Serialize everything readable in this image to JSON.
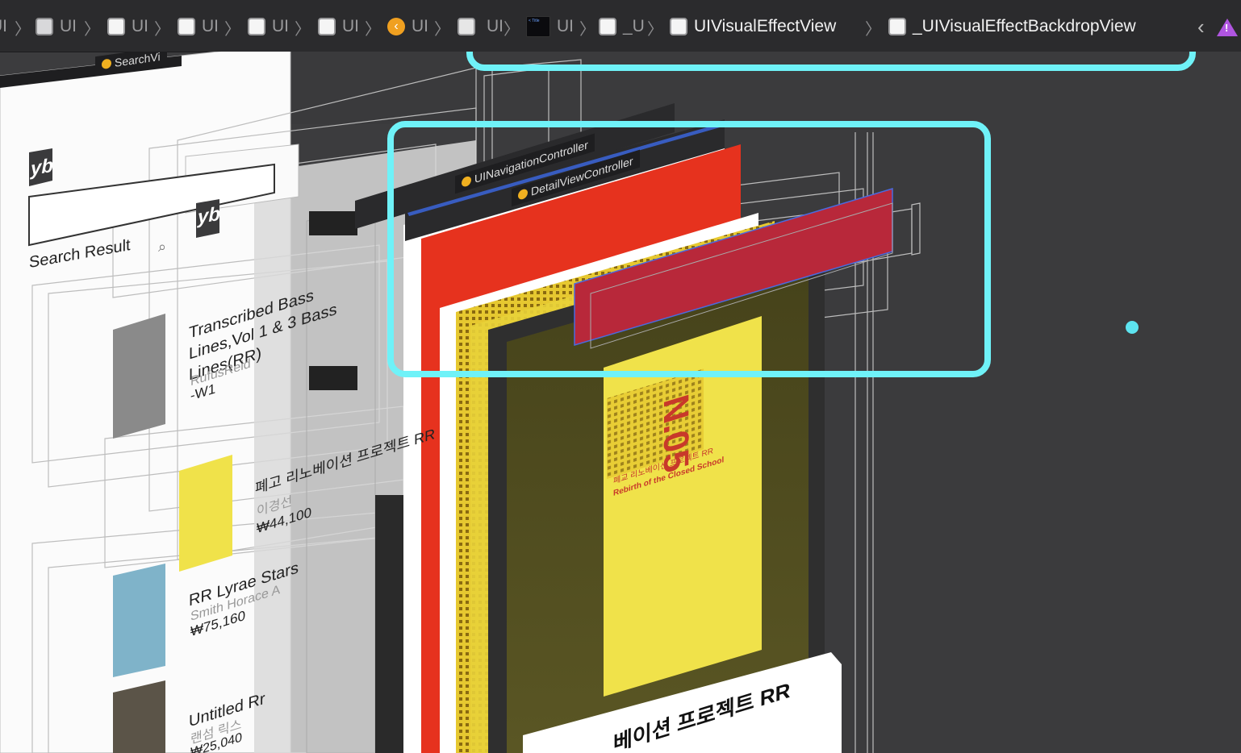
{
  "breadcrumb": {
    "items": [
      {
        "label": "UI"
      },
      {
        "label": "UI"
      },
      {
        "label": "UI"
      },
      {
        "label": "UI"
      },
      {
        "label": "UI"
      },
      {
        "label": "UI"
      },
      {
        "label": "UI"
      },
      {
        "label": "UI"
      },
      {
        "label": "_U"
      },
      {
        "label": "UIVisualEffectView"
      },
      {
        "label": "_UIVisualEffectBackdropView"
      }
    ],
    "nav_title_icon_text": "< Title"
  },
  "hierarchy": {
    "search_tag": "SearchVi",
    "nav_controller_tag": "UINavigationController",
    "detail_controller_tag": "DetailViewController",
    "search_result_label": "Search Result",
    "logo_text": "yb"
  },
  "results": [
    {
      "title": "Transcribed Bass Lines,Vol 1 & 3 Bass Lines(RR)",
      "author": "RufusReid",
      "price": "-W1"
    },
    {
      "title": "폐고 리노베이션 프로젝트 RR",
      "author": "이경선",
      "price": "₩44,100"
    },
    {
      "title": "RR Lyrae Stars",
      "author": "Smith Horace A",
      "price": "₩75,160"
    },
    {
      "title": "Untitled Rr",
      "author": "랜섬 릭스",
      "price": "₩25,040"
    }
  ],
  "detail": {
    "cover_big_text": "N.05",
    "cover_sub_korean": "폐교 리노베이션 프로젝트 RR",
    "cover_sub_english": "Rebirth of the Closed School",
    "bottom_title": "베이션 프로젝트 RR"
  },
  "colors": {
    "highlight": "#6ff2f8",
    "red_view": "#e6321e",
    "crimson_view": "#b8283a",
    "cover_yellow": "#f0e24a"
  }
}
